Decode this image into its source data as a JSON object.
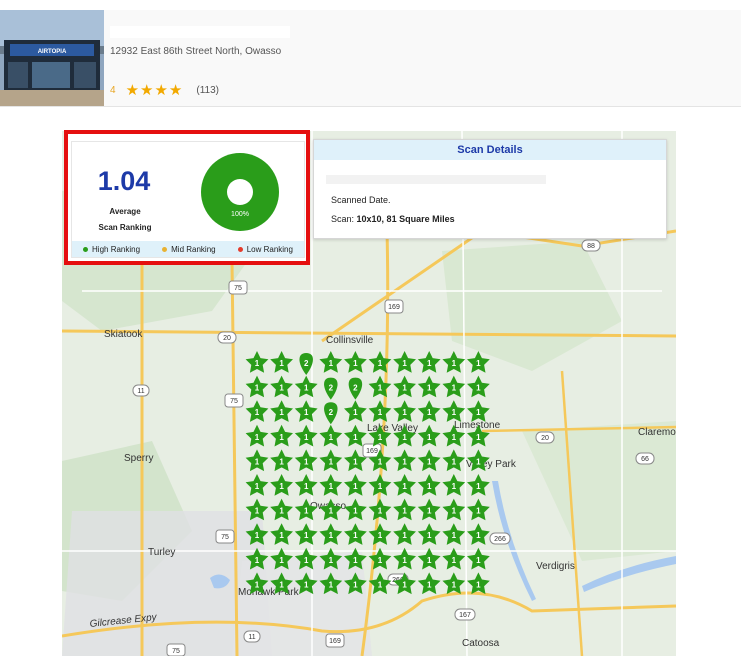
{
  "business": {
    "address": "12932 East 86th Street North, Owasso",
    "rating": "4",
    "stars": [
      "★",
      "★",
      "★",
      "★"
    ],
    "review_count": "(113)",
    "sign_text": "AIRTOPIA"
  },
  "summary": {
    "average": "1.04",
    "label_line1": "Average",
    "label_line2": "Scan Ranking",
    "donut_percent": "100%",
    "donut_fraction": 1.0,
    "legend": [
      {
        "label": "High Ranking",
        "color": "#2a9d1a"
      },
      {
        "label": "Mid Ranking",
        "color": "#e8b233"
      },
      {
        "label": "Low Ranking",
        "color": "#e53b2b"
      }
    ]
  },
  "scan_details": {
    "title": "Scan Details",
    "scanned_date": "Scanned Date.",
    "scan_prefix": "Scan:",
    "scan_value": "10x10, 81 Square Miles"
  },
  "map": {
    "places": [
      "Skiatook",
      "Collinsville",
      "Sperry",
      "Limestone",
      "Valley Park",
      "Owasso",
      "Turley",
      "Verdigris",
      "Catoosa",
      "Claremore",
      "Gilcrease Expy",
      "Lake Valley",
      "Mohawk Park"
    ],
    "shields": [
      "88",
      "75",
      "169",
      "20",
      "11",
      "75",
      "20",
      "169",
      "66",
      "266",
      "75",
      "266",
      "167",
      "11",
      "169",
      "75"
    ],
    "grid": [
      [
        1,
        1,
        2,
        1,
        1,
        1,
        1,
        1,
        1,
        1
      ],
      [
        1,
        1,
        1,
        2,
        2,
        1,
        1,
        1,
        1,
        1
      ],
      [
        1,
        1,
        1,
        2,
        1,
        1,
        1,
        1,
        1,
        1
      ],
      [
        1,
        1,
        1,
        1,
        1,
        1,
        1,
        1,
        1,
        1
      ],
      [
        1,
        1,
        1,
        1,
        1,
        1,
        1,
        1,
        1,
        1
      ],
      [
        1,
        1,
        1,
        1,
        1,
        1,
        1,
        1,
        1,
        1
      ],
      [
        1,
        1,
        1,
        1,
        1,
        1,
        1,
        1,
        1,
        1
      ],
      [
        1,
        1,
        1,
        1,
        1,
        1,
        1,
        1,
        1,
        1
      ],
      [
        1,
        1,
        1,
        1,
        1,
        1,
        1,
        1,
        1,
        1
      ],
      [
        1,
        1,
        1,
        1,
        1,
        1,
        1,
        1,
        1,
        1
      ]
    ],
    "pin_color": "#2a9d1a"
  }
}
